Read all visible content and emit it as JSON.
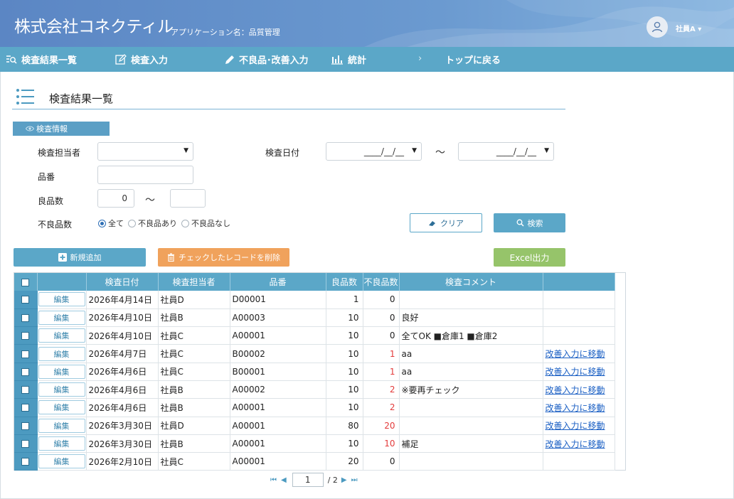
{
  "header": {
    "company": "株式会社コネクティル",
    "app_label": "アプリケーション名：",
    "app_name": "品質管理",
    "user": "社員A ▾"
  },
  "nav": {
    "items": [
      {
        "label": "検査結果一覧",
        "icon": "list-search-icon"
      },
      {
        "label": "検査入力",
        "icon": "edit-icon"
      },
      {
        "label": "不良品･改善入力",
        "icon": "pen-icon"
      },
      {
        "label": "統計",
        "icon": "bar-chart-icon"
      }
    ],
    "separator": "›",
    "back_label": "トップに戻る"
  },
  "page": {
    "title": "検査結果一覧"
  },
  "search": {
    "badge": "検査情報",
    "inspector_label": "検査担当者",
    "inspector_value": "",
    "date_label": "検査日付",
    "date_from": "____/__/__",
    "date_to": "____/__/__",
    "tilde": "～",
    "part_label": "品番",
    "part_value": "",
    "good_label": "良品数",
    "good_from": "0",
    "good_to": "",
    "defect_label": "不良品数",
    "radio_options": [
      "全て",
      "不良品あり",
      "不良品なし"
    ],
    "radio_selected": "全て",
    "clear_label": "クリア",
    "search_label": "検索"
  },
  "actions": {
    "new_label": "新規追加",
    "delete_label": "チェックしたレコードを削除",
    "excel_label": "Excel出力"
  },
  "table": {
    "headers": [
      "検査日付",
      "検査担当者",
      "品番",
      "良品数",
      "不良品数",
      "検査コメント"
    ],
    "edit_label": "編集",
    "rows": [
      {
        "date": "2026年4月14日",
        "inspector": "社員D",
        "part": "D00001",
        "good": "1",
        "defect": "0",
        "comment": "",
        "link": ""
      },
      {
        "date": "2026年4月10日",
        "inspector": "社員B",
        "part": "A00003",
        "good": "10",
        "defect": "0",
        "comment": "良好",
        "link": ""
      },
      {
        "date": "2026年4月10日",
        "inspector": "社員C",
        "part": "A00001",
        "good": "10",
        "defect": "0",
        "comment": "全てOK ■倉庫1 ■倉庫2",
        "link": ""
      },
      {
        "date": "2026年4月7日",
        "inspector": "社員C",
        "part": "B00002",
        "good": "10",
        "defect": "1",
        "comment": "aa",
        "link": "改善入力に移動"
      },
      {
        "date": "2026年4月6日",
        "inspector": "社員C",
        "part": "B00001",
        "good": "10",
        "defect": "1",
        "comment": "aa",
        "link": "改善入力に移動"
      },
      {
        "date": "2026年4月6日",
        "inspector": "社員B",
        "part": "A00002",
        "good": "10",
        "defect": "2",
        "comment": "※要再チェック",
        "link": "改善入力に移動"
      },
      {
        "date": "2026年4月6日",
        "inspector": "社員B",
        "part": "A00001",
        "good": "10",
        "defect": "2",
        "comment": "",
        "link": "改善入力に移動"
      },
      {
        "date": "2026年3月30日",
        "inspector": "社員D",
        "part": "A00001",
        "good": "80",
        "defect": "20",
        "comment": "",
        "link": "改善入力に移動"
      },
      {
        "date": "2026年3月30日",
        "inspector": "社員B",
        "part": "A00001",
        "good": "10",
        "defect": "10",
        "comment": "補足",
        "link": "改善入力に移動"
      },
      {
        "date": "2026年2月10日",
        "inspector": "社員C",
        "part": "A00001",
        "good": "20",
        "defect": "0",
        "comment": "",
        "link": ""
      }
    ]
  },
  "pager": {
    "current": "1",
    "total": "/ 2"
  },
  "colors": {
    "header": "#6b9ad0",
    "nav": "#5ba7c8",
    "accent": "#5ba7c8",
    "delete": "#f0a25c",
    "excel": "#96c46a",
    "defect_red": "#e33b3b",
    "link": "#1a5fc4"
  }
}
